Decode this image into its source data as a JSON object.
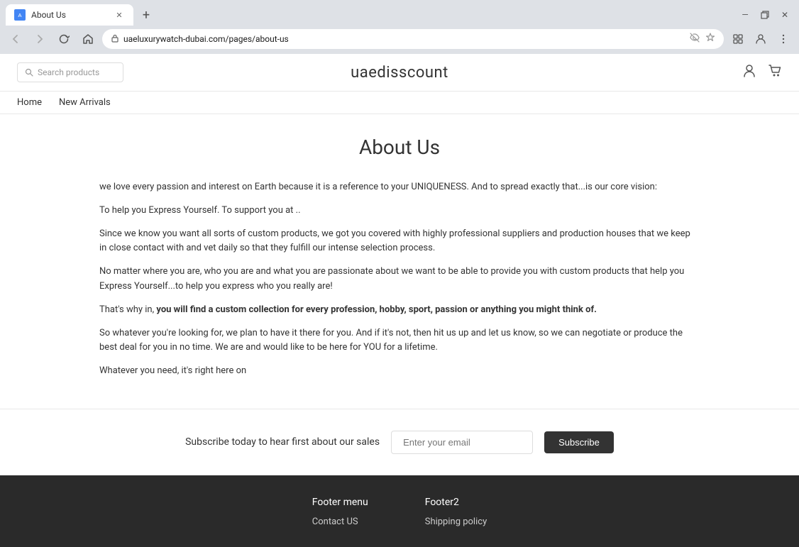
{
  "browser": {
    "tab_title": "About Us",
    "tab_favicon": "A",
    "url": "uaeluxurywatch-dubai.com/pages/about-us",
    "new_tab_icon": "+",
    "back_icon": "←",
    "forward_icon": "→",
    "refresh_icon": "↻",
    "home_icon": "⌂",
    "window_minimize": "—",
    "window_restore": "⧉",
    "window_close": "✕"
  },
  "header": {
    "search_placeholder": "Search products",
    "logo": "uaedisscount",
    "account_icon": "👤",
    "cart_icon": "🛒"
  },
  "nav": {
    "items": [
      {
        "label": "Home"
      },
      {
        "label": "New Arrivals"
      }
    ]
  },
  "main": {
    "page_title": "About Us",
    "paragraphs": [
      {
        "id": "p1",
        "text": "we love every passion and interest on Earth because it is a reference to your UNIQUENESS. And to spread exactly that...is our core vision:",
        "bold": false
      },
      {
        "id": "p2",
        "text": "To help you Express Yourself. To support you at ..",
        "bold": false
      },
      {
        "id": "p3",
        "text": "Since we know you want all sorts of custom products, we got you covered with highly professional suppliers and production houses that we keep in close contact with and vet daily so that they fulfill our intense selection process.",
        "bold": false
      },
      {
        "id": "p4",
        "text": "No matter where you are, who you are and what you are passionate about we want to be able to provide you with custom products that help you Express Yourself...to help you express who you really are!",
        "bold": false
      },
      {
        "id": "p5",
        "text_before": "That's why in, ",
        "text_bold": "you will find a custom collection for every profession, hobby, sport, passion or anything you might think of.",
        "has_bold": true
      },
      {
        "id": "p6",
        "text": "So whatever you're looking for, we plan to have it there for you. And if it's not, then hit us up and let us know, so we can negotiate or produce the best deal for you in no time. We are and would like to be here for YOU for a lifetime.",
        "bold": false
      },
      {
        "id": "p7",
        "text": "Whatever you need, it's right here on",
        "bold": false
      }
    ]
  },
  "subscribe": {
    "label": "Subscribe today to hear first about our sales",
    "email_placeholder": "Enter your email",
    "button_label": "Subscribe"
  },
  "footer": {
    "col1": {
      "title": "Footer menu",
      "links": [
        "Contact US"
      ]
    },
    "col2": {
      "title": "Footer2",
      "links": [
        "Shipping policy"
      ]
    }
  }
}
